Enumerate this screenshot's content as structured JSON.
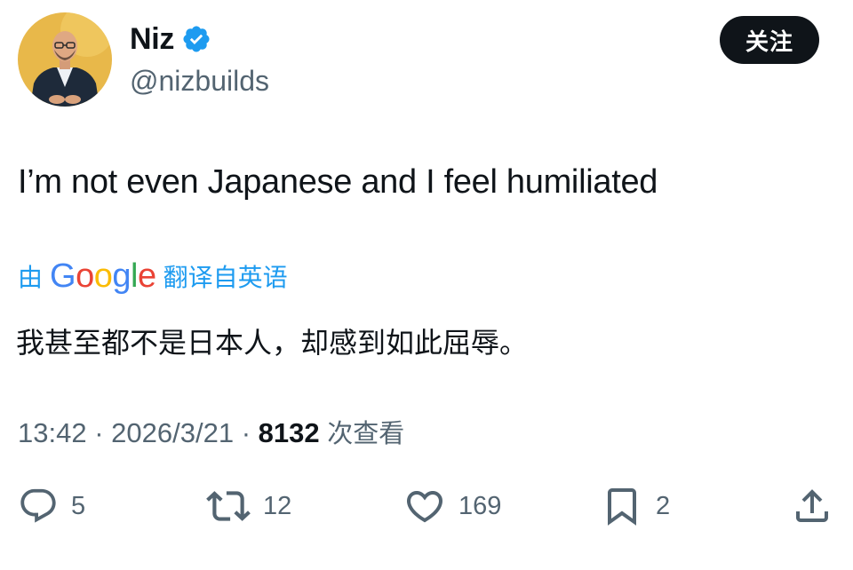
{
  "author": {
    "display_name": "Niz",
    "handle": "@nizbuilds",
    "verified_icon": "verified-badge-icon",
    "avatar_bg": "#e8b84a"
  },
  "follow_button": {
    "label": "关注"
  },
  "tweet": {
    "text": "I’m not even Japanese and I feel humiliated"
  },
  "translation": {
    "prefix": "由",
    "google_logo": "Google",
    "suffix": "翻译自英语",
    "text": "我甚至都不是日本人，却感到如此屈辱。",
    "link_color": "#1d9bf0"
  },
  "meta": {
    "time": "13:42",
    "separator": "·",
    "date": "2026/3/21",
    "views_count": "8132",
    "views_label": "次查看"
  },
  "actions": {
    "reply": {
      "icon": "reply-icon",
      "count": "5"
    },
    "retweet": {
      "icon": "retweet-icon",
      "count": "12"
    },
    "like": {
      "icon": "heart-icon",
      "count": "169"
    },
    "bookmark": {
      "icon": "bookmark-icon",
      "count": "2"
    },
    "share": {
      "icon": "share-icon"
    }
  },
  "colors": {
    "text_primary": "#0f1419",
    "text_secondary": "#536471",
    "accent": "#1d9bf0",
    "button_bg": "#0f1419"
  }
}
